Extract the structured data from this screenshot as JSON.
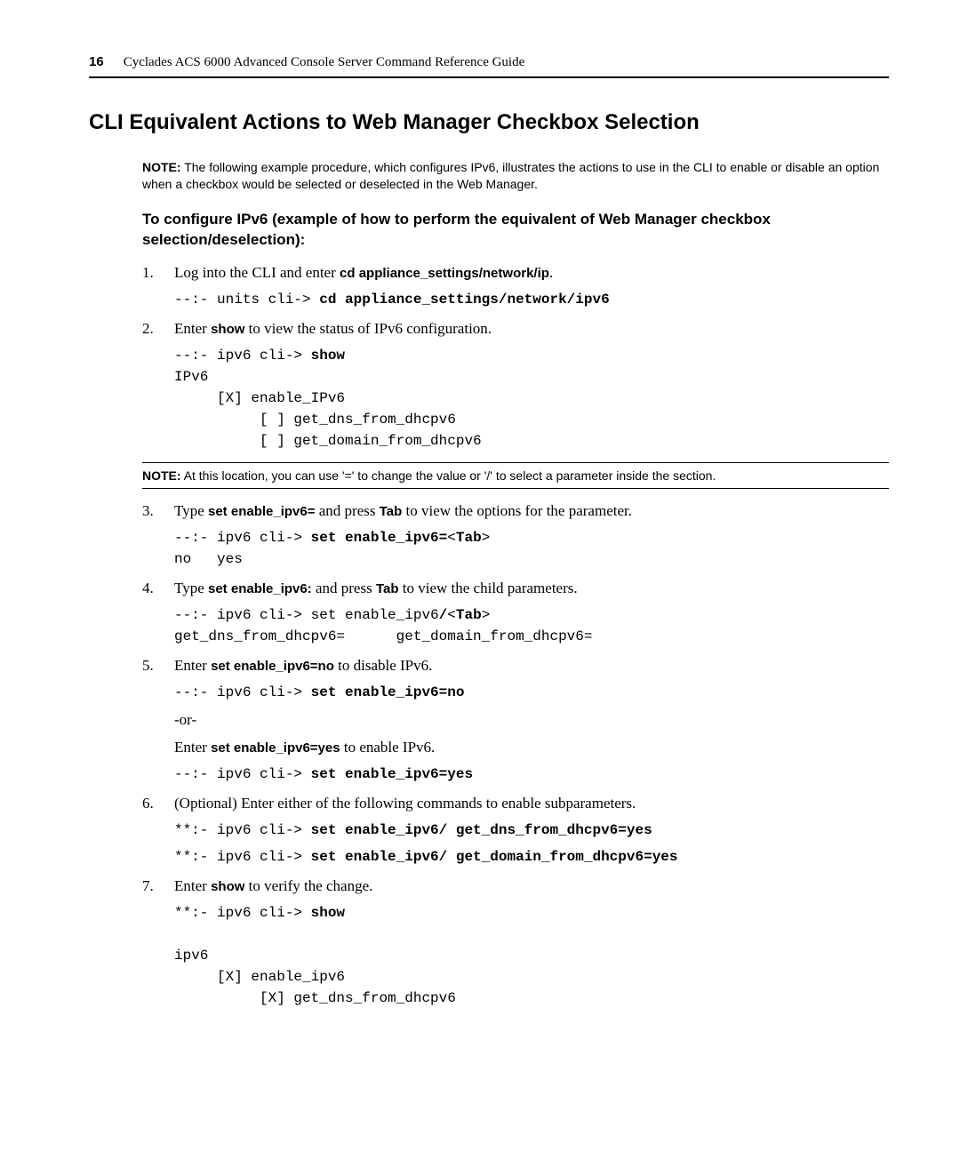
{
  "header": {
    "page_number": "16",
    "guide_title": "Cyclades ACS 6000 Advanced Console Server Command Reference Guide"
  },
  "section_title": "CLI Equivalent Actions to Web Manager Checkbox Selection",
  "note1": {
    "label": "NOTE:",
    "text": " The following example procedure, which configures IPv6, illustrates the actions to use in the CLI to enable or disable an option when a checkbox would be selected or deselected in the Web Manager."
  },
  "subheading": "To configure IPv6 (example of how to perform the equivalent of Web Manager checkbox selection/deselection):",
  "steps": {
    "s1": {
      "num": "1.",
      "pre": "Log into the CLI and enter ",
      "cmd": "cd appliance_settings/network/ip",
      "post": ".",
      "code_pre": "--:- units cli-> ",
      "code_bold": "cd appliance_settings/network/ipv6"
    },
    "s2": {
      "num": "2.",
      "pre": "Enter ",
      "cmd": "show",
      "post": " to view the status of IPv6 configuration.",
      "code_pre": "--:- ipv6 cli-> ",
      "code_bold": "show",
      "code_tail": "\nIPv6\n     [X] enable_IPv6\n          [ ] get_dns_from_dhcpv6\n          [ ] get_domain_from_dhcpv6"
    },
    "note2": {
      "label": "NOTE:",
      "text": " At this location, you can use '=' to change the value or '/' to select a parameter inside the section."
    },
    "s3": {
      "num": "3.",
      "pre": "Type ",
      "cmd": "set enable_ipv6=",
      "mid": " and press ",
      "cmd2": "Tab",
      "post": " to view the options for the parameter.",
      "code_pre": "--:- ipv6 cli-> ",
      "code_bold": "set enable_ipv6=",
      "code_tab": "<",
      "code_tab_b": "Tab",
      "code_tab_end": ">",
      "code_tail": "\nno   yes"
    },
    "s4": {
      "num": "4.",
      "pre": "Type ",
      "cmd": "set enable_ipv6:",
      "mid": " and press ",
      "cmd2": "Tab",
      "post": " to view the child parameters.",
      "code_pre": "--:- ipv6 cli-> set enable_ipv6",
      "code_bold_slash": "/",
      "code_tab": "<",
      "code_tab_b": "Tab",
      "code_tab_end": ">",
      "code_tail": "\nget_dns_from_dhcpv6=      get_domain_from_dhcpv6="
    },
    "s5": {
      "num": "5.",
      "pre": "Enter ",
      "cmd": "set enable_ipv6=no",
      "post": " to disable IPv6.",
      "code_pre": "--:- ipv6 cli-> ",
      "code_bold": "set enable_ipv6=no",
      "or": "-or-",
      "pre2": "Enter ",
      "cmd2": "set enable_ipv6=yes",
      "post2": " to enable IPv6.",
      "code2_pre": "--:- ipv6 cli-> ",
      "code2_bold": "set enable_ipv6=yes"
    },
    "s6": {
      "num": "6.",
      "text": "(Optional) Enter either of the following commands to enable subparameters.",
      "code1_pre": "**:- ipv6 cli-> ",
      "code1_bold": "set enable_ipv6/ get_dns_from_dhcpv6=yes",
      "code2_pre": "**:- ipv6 cli-> ",
      "code2_bold": "set enable_ipv6/ get_domain_from_dhcpv6=yes"
    },
    "s7": {
      "num": "7.",
      "pre": "Enter ",
      "cmd": "show",
      "post": " to verify the change.",
      "code_pre": "**:- ipv6 cli-> ",
      "code_bold": "show",
      "code_tail": "\n\nipv6\n     [X] enable_ipv6\n          [X] get_dns_from_dhcpv6"
    }
  }
}
